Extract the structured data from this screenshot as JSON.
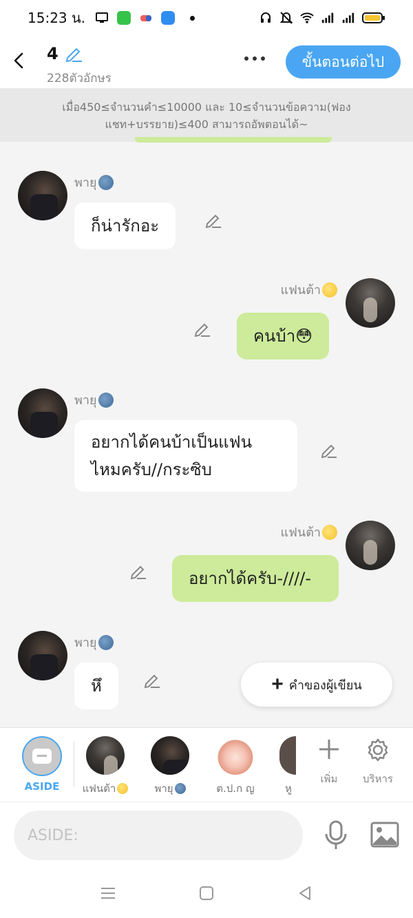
{
  "status_bar": {
    "time": "15:23 น.",
    "icons": [
      "screen-mirror-icon",
      "app-icon",
      "game-icon",
      "app-icon",
      "dot-icon",
      "headset-icon",
      "mute-icon",
      "wifi-icon",
      "signal-icon",
      "battery-icon"
    ]
  },
  "header": {
    "episode_number": "4",
    "char_count": "228ตัวอักษร",
    "next_button": "ขั้นตอนต่อไป"
  },
  "notice": "เมื่อ450≤จำนวนคำ≤10000 และ 10≤จำนวนข้อความ(ฟองแชท+บรรยาย)≤400 สามารถอัพตอนได้~",
  "messages": [
    {
      "side": "left",
      "name": "พายุ",
      "text": "ก็น่ารักอะ"
    },
    {
      "side": "right",
      "name": "แฟนต้า",
      "text": "คนบ้า😳"
    },
    {
      "side": "left",
      "name": "พายุ",
      "text": "อยากได้คนบ้าเป็นแฟน"
    },
    {
      "side": "left",
      "name": "พายุ",
      "text": "ไหมครับ//กระซิบ"
    },
    {
      "side": "right",
      "name": "แฟนต้า",
      "text": "อยากได้ครับ-////-"
    },
    {
      "side": "left",
      "name": "พายุ",
      "text": "หึ"
    }
  ],
  "author_button": "คำของผู้เขียน",
  "character_bar": {
    "aside_label": "ASIDE",
    "characters": [
      "แฟนต้า",
      "พายุ",
      "ต.ป.ก ญ",
      "หู"
    ],
    "add_label": "เพิ่ม",
    "manage_label": "บริหาร"
  },
  "input": {
    "placeholder": "ASIDE:"
  },
  "colors": {
    "accent": "#4aa6f2",
    "bubble_right": "#cdeb9a",
    "bubble_left": "#ffffff"
  }
}
